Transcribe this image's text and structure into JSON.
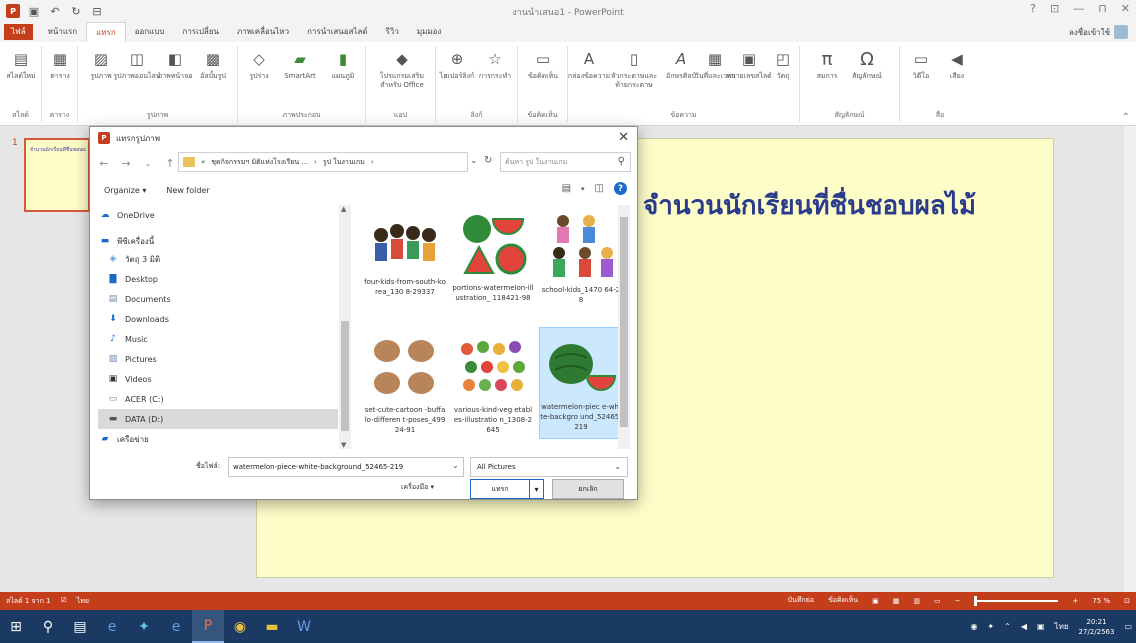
{
  "window": {
    "title": "งานนำเสนอ1 - PowerPoint",
    "controls": [
      "?",
      "⊡",
      "—",
      "⊓",
      "✕"
    ]
  },
  "quick_access": {
    "app_logo": "P",
    "save_icon": "save-icon",
    "undo_icon": "undo-icon",
    "redo_icon": "redo-icon",
    "customize_icon": "customize-icon"
  },
  "tabs": [
    {
      "label": "ไฟล์"
    },
    {
      "label": "หน้าแรก"
    },
    {
      "label": "แทรก"
    },
    {
      "label": "ออกแบบ"
    },
    {
      "label": "การเปลี่ยน"
    },
    {
      "label": "ภาพเคลื่อนไหว"
    },
    {
      "label": "การนำเสนอสไลด์"
    },
    {
      "label": "รีวิว"
    },
    {
      "label": "มุมมอง"
    }
  ],
  "signin": "ลงชื่อเข้าใช้",
  "ribbon": {
    "groups": [
      {
        "label": "สไลด์",
        "buttons": [
          "สไลด์ใหม่"
        ]
      },
      {
        "label": "ตาราง",
        "buttons": [
          "ตาราง"
        ]
      },
      {
        "label": "รูปภาพ",
        "buttons": [
          "รูปภาพ",
          "รูปภาพออนไลน์",
          "ภาพหน้าจอ",
          "อัลบั้มรูป"
        ]
      },
      {
        "label": "ภาพประกอบ",
        "buttons": [
          "รูปร่าง",
          "SmartArt",
          "แผนภูมิ"
        ]
      },
      {
        "label": "แอป",
        "buttons": [
          "โปรแกรมเสริมสำหรับ Office"
        ]
      },
      {
        "label": "ลิงก์",
        "buttons": [
          "ไฮเปอร์ลิงก์",
          "การกระทำ"
        ]
      },
      {
        "label": "ข้อคิดเห็น",
        "buttons": [
          "ข้อคิดเห็น"
        ]
      },
      {
        "label": "ข้อความ",
        "buttons": [
          "กล่องข้อความ",
          "หัวกระดาษและท้ายกระดาษ",
          "อักษรศิลป์",
          "วันที่และเวลา",
          "หมายเลขสไลด์",
          "วัตถุ"
        ]
      },
      {
        "label": "สัญลักษณ์",
        "buttons": [
          "สมการ",
          "สัญลักษณ์"
        ]
      },
      {
        "label": "สื่อ",
        "buttons": [
          "วิดีโอ",
          "เสียง"
        ]
      }
    ]
  },
  "slide": {
    "number": "1",
    "title": "จำนวนนักเรียนที่ชื่นชอบผลไม้",
    "thumb_text": "จำนวนนักเรียนที่ชื่นชอบผลไม้"
  },
  "dialog": {
    "title": "แทรกรูปภาพ",
    "address": [
      "«",
      "ชุดกิจกรรมฯ มิติแห่งโรงเรียน ...",
      "›",
      "รูป ในงานเกม",
      "›"
    ],
    "search_placeholder": "ค้นหา รูป ในงานเกม",
    "organize": "Organize ▾",
    "new_folder": "New folder",
    "nav_items": [
      {
        "label": "OneDrive",
        "icon": "cloud-icon"
      },
      {
        "label": "พีซีเครื่องนี้",
        "icon": "computer-icon"
      },
      {
        "label": "วัตถุ 3 มิติ",
        "icon": "cube-icon"
      },
      {
        "label": "Desktop",
        "icon": "desktop-icon"
      },
      {
        "label": "Documents",
        "icon": "documents-icon"
      },
      {
        "label": "Downloads",
        "icon": "download-icon"
      },
      {
        "label": "Music",
        "icon": "music-icon"
      },
      {
        "label": "Pictures",
        "icon": "pictures-icon"
      },
      {
        "label": "Videos",
        "icon": "videos-icon"
      },
      {
        "label": "ACER (C:)",
        "icon": "drive-icon"
      },
      {
        "label": "DATA (D:)",
        "icon": "drive-icon"
      },
      {
        "label": "เครือข่าย",
        "icon": "network-icon"
      }
    ],
    "files": [
      {
        "label": "four-kids-from-south-korea_130 8-29337",
        "image": "kids"
      },
      {
        "label": "portions-watermelon-illustration_ 118421-98",
        "image": "watermelon-portions"
      },
      {
        "label": "school-kids_1470 64-28",
        "image": "school-kids"
      },
      {
        "label": "set-cute-cartoon -buffalo-differen t-poses_49924-91",
        "image": "buffalo"
      },
      {
        "label": "various-kind-veg etables-illustratio n_1308-2645",
        "image": "vegetables"
      },
      {
        "label": "watermelon-piec e-white-backgro und_52465-219",
        "image": "watermelon"
      }
    ],
    "selected_file": 5,
    "filename_label": "ชื่อไฟล์:",
    "filename_value": "watermelon-piece-white-background_52465-219",
    "filetype": "All Pictures",
    "tools": "เครื่องมือ ▾",
    "insert": "แทรก",
    "cancel": "ยกเลิก"
  },
  "status": {
    "slide_of": "สไลด์ 1 จาก 1",
    "language": "ไทย",
    "notes": "บันทึกย่อ",
    "comments": "ข้อคิดเห็น",
    "zoom": "75 %"
  },
  "taskbar": {
    "lang": "ไทย",
    "time": "20:21",
    "date": "27/2/2563"
  }
}
